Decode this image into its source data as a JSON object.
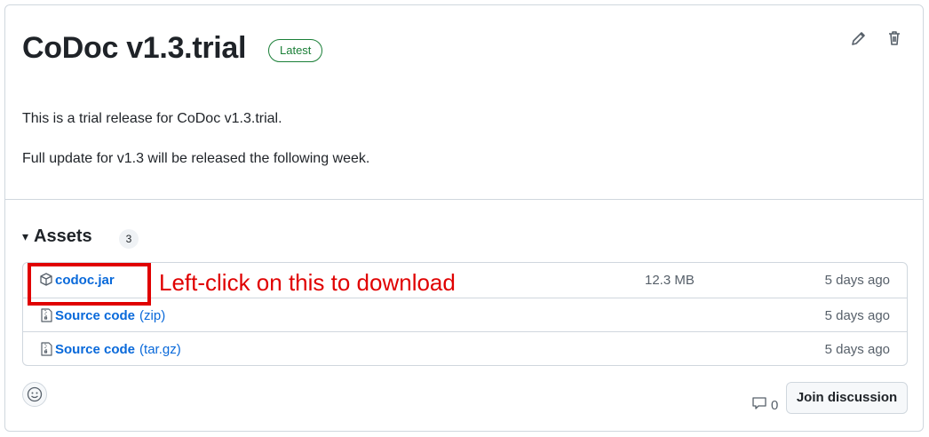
{
  "release": {
    "title": "CoDoc v1.3.trial",
    "badge": "Latest",
    "description_lines": [
      "This is a trial release for CoDoc v1.3.trial.",
      "Full update for v1.3 will be released the following week."
    ],
    "actions": {
      "edit_icon": "pencil-icon",
      "delete_icon": "trash-icon"
    }
  },
  "assets": {
    "heading": "Assets",
    "caret": "▾",
    "count": "3",
    "items": [
      {
        "name": "codoc.jar",
        "ext": "",
        "size": "12.3 MB",
        "date": "5 days ago",
        "icon": "package-icon"
      },
      {
        "name": "Source code",
        "ext": "(zip)",
        "size": "",
        "date": "5 days ago",
        "icon": "file-zip-icon"
      },
      {
        "name": "Source code",
        "ext": "(tar.gz)",
        "size": "",
        "date": "5 days ago",
        "icon": "file-zip-icon"
      }
    ]
  },
  "annotation": {
    "text": "Left-click on this to download",
    "color": "#e00000"
  },
  "footer": {
    "emoji_icon": "smiley-icon",
    "comment_icon": "comment-icon",
    "comment_count": "0",
    "join_label": "Join discussion"
  },
  "colors": {
    "link": "#0969da",
    "badge_green": "#1a7f37",
    "border": "#d0d7de",
    "muted": "#57606a"
  }
}
